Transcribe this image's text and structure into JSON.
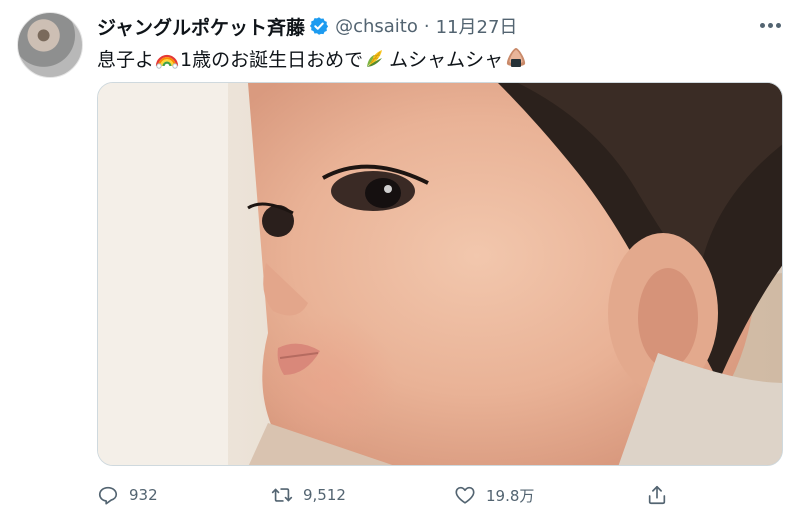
{
  "tweet": {
    "display_name": "ジャングルポケット斉藤",
    "handle": "@chsaito",
    "separator": "·",
    "date": "11月27日",
    "text_part1": "息子よ",
    "text_part2": "1歳のお誕生日おめで",
    "text_part3": "ムシャムシャ",
    "emojis": [
      "rainbow-emoji",
      "corn-emoji",
      "onigiri-emoji"
    ]
  },
  "actions": {
    "replies": "932",
    "retweets": "9,512",
    "likes": "19.8万"
  },
  "colors": {
    "verified": "#1d9bf0",
    "secondary_text": "#536471",
    "primary_text": "#0f1419"
  }
}
